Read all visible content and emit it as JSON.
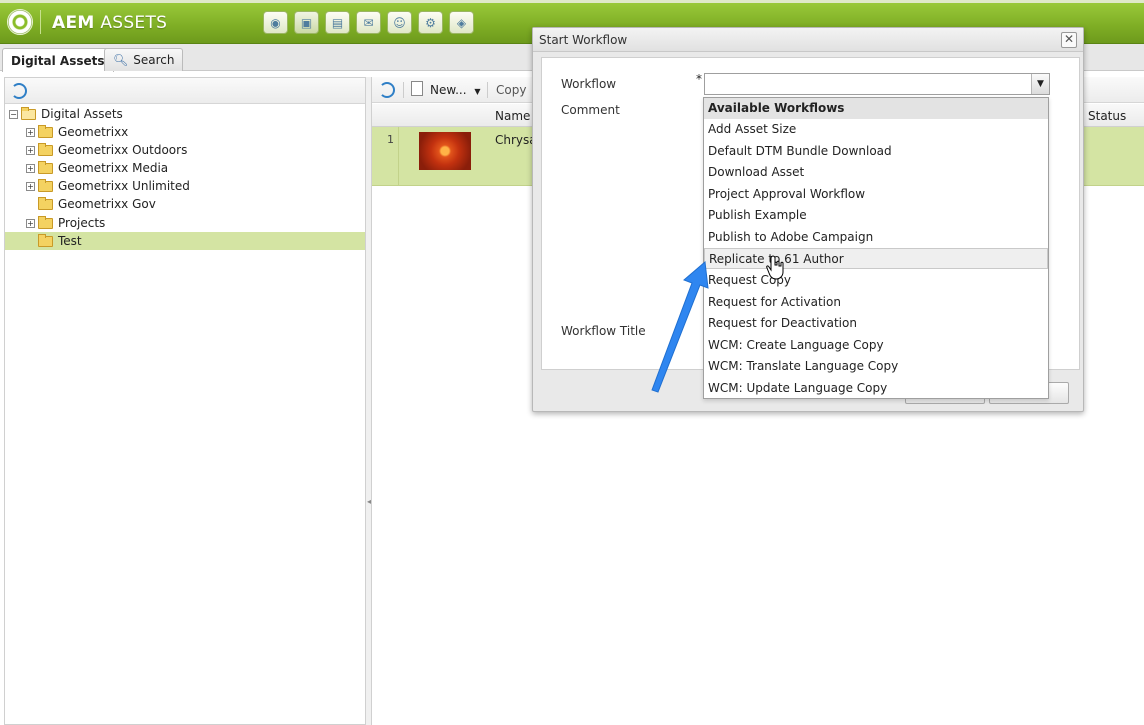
{
  "header": {
    "title_bold": "AEM",
    "title_rest": "ASSETS",
    "nav_icons": [
      "globe-icon",
      "image-icon",
      "campaign-icon",
      "mail-icon",
      "people-icon",
      "tools-icon",
      "tag-icon"
    ]
  },
  "tabs": [
    {
      "label": "Digital Assets",
      "active": true
    },
    {
      "label": "Search",
      "active": false
    }
  ],
  "tree": {
    "root": "Digital Assets",
    "items": [
      {
        "label": "Geometrixx",
        "expandable": true
      },
      {
        "label": "Geometrixx Outdoors",
        "expandable": true
      },
      {
        "label": "Geometrixx Media",
        "expandable": true
      },
      {
        "label": "Geometrixx Unlimited",
        "expandable": true
      },
      {
        "label": "Geometrixx Gov",
        "expandable": false
      },
      {
        "label": "Projects",
        "expandable": true
      },
      {
        "label": "Test",
        "expandable": false,
        "selected": true
      }
    ]
  },
  "toolbar": {
    "new_label": "New...",
    "copy_label": "Copy"
  },
  "grid": {
    "columns": {
      "name": "Name",
      "status": "Status"
    },
    "rows": [
      {
        "index": "1",
        "name": "Chrysan"
      }
    ]
  },
  "dialog": {
    "title": "Start Workflow",
    "close_label": "✕",
    "labels": {
      "workflow": "Workflow",
      "comment": "Comment",
      "workflow_title": "Workflow Title",
      "required_mark": "*"
    },
    "workflow_value": ""
  },
  "dropdown": {
    "header": "Available Workflows",
    "options": [
      "Add Asset Size",
      "Default DTM Bundle Download",
      "Download Asset",
      "Project Approval Workflow",
      "Publish Example",
      "Publish to Adobe Campaign",
      "Replicate to 61 Author",
      "Request Copy",
      "Request for Activation",
      "Request for Deactivation",
      "WCM: Create Language Copy",
      "WCM: Translate Language Copy",
      "WCM: Update Language Copy"
    ],
    "hovered": "Replicate to 61 Author"
  },
  "colors": {
    "header_green": "#8bbd2a",
    "selection_green": "#d4e4a3",
    "annotation_arrow": "#2f86f0"
  }
}
